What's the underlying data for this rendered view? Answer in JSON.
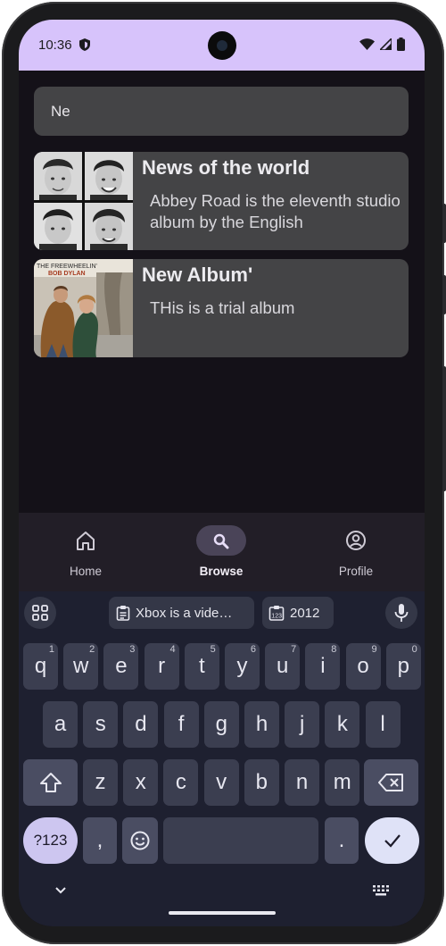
{
  "status_bar": {
    "time": "10:36",
    "icons": [
      "shield-icon",
      "wifi-icon",
      "signal-icon",
      "battery-icon"
    ]
  },
  "search": {
    "value": "Ne"
  },
  "results": [
    {
      "title": "News of the world",
      "description": "Abbey Road is the eleventh studio album by the English"
    },
    {
      "title": "New Album'",
      "description": "THis is a trial album",
      "cover_text_1": "THE FREEWHEELIN'",
      "cover_text_2": "BOB DYLAN"
    }
  ],
  "nav": {
    "items": [
      {
        "label": "Home",
        "icon": "home-icon"
      },
      {
        "label": "Browse",
        "icon": "search-icon",
        "active": true
      },
      {
        "label": "Profile",
        "icon": "account-circle-icon"
      }
    ]
  },
  "keyboard": {
    "suggestions": [
      "Xbox is a vide…",
      "2012"
    ],
    "row1": [
      {
        "k": "q",
        "h": "1"
      },
      {
        "k": "w",
        "h": "2"
      },
      {
        "k": "e",
        "h": "3"
      },
      {
        "k": "r",
        "h": "4"
      },
      {
        "k": "t",
        "h": "5"
      },
      {
        "k": "y",
        "h": "6"
      },
      {
        "k": "u",
        "h": "7"
      },
      {
        "k": "i",
        "h": "8"
      },
      {
        "k": "o",
        "h": "9"
      },
      {
        "k": "p",
        "h": "0"
      }
    ],
    "row2": [
      "a",
      "s",
      "d",
      "f",
      "g",
      "h",
      "j",
      "k",
      "l"
    ],
    "row3": [
      "z",
      "x",
      "c",
      "v",
      "b",
      "n",
      "m"
    ],
    "symbols_label": "?123",
    "comma": ",",
    "period": "."
  },
  "colors": {
    "status_bar": "#d7c3fb",
    "background": "#141118",
    "card": "#444446",
    "keyboard": "#1e2030",
    "accent": "#cdc6f0"
  }
}
